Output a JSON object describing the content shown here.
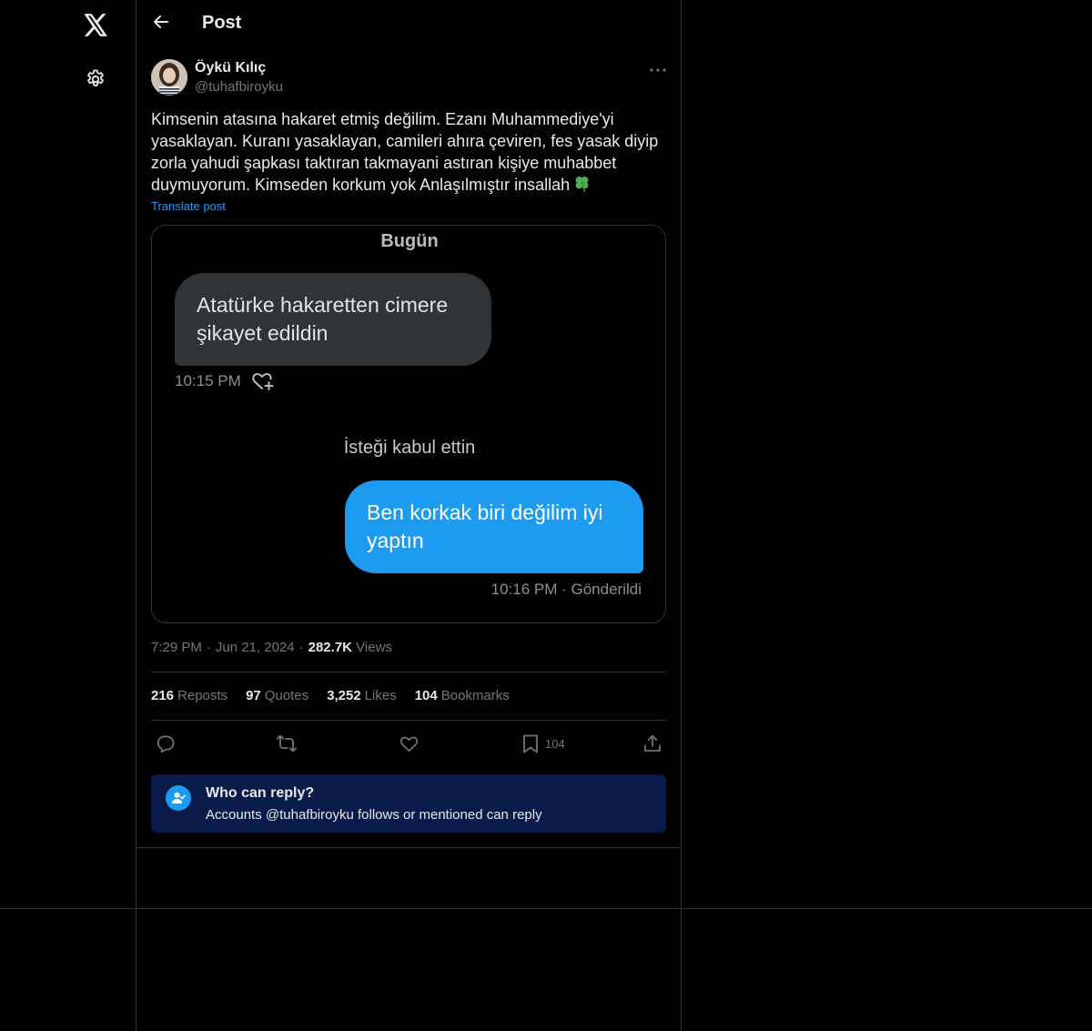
{
  "nav": {
    "logo_icon": "x-logo-icon",
    "settings_icon": "gear-icon"
  },
  "header": {
    "title": "Post",
    "back_icon": "arrow-left-icon"
  },
  "post": {
    "author_name": "Öykü Kılıç",
    "author_handle": "@tuhafbiroyku",
    "text": "Kimsenin atasına hakaret etmiş değilim. Ezanı Muhammediye'yi yasaklayan. Kuranı yasaklayan, camileri ahıra çeviren, fes yasak diyip zorla yahudi şapkası taktıran takmayani astıran kişiye muhabbet duymuyorum. Kimseden korkum yok Anlaşılmıştır insallah",
    "translate_label": "Translate post",
    "time": "7:29 PM",
    "date": "Jun 21, 2024",
    "views_count": "282.7K",
    "views_label": "Views"
  },
  "media": {
    "date_label": "Bugün",
    "incoming_message": "Atatürke hakaretten cimere şikayet edildin",
    "incoming_time": "10:15 PM",
    "accept_notice": "İsteği kabul ettin",
    "outgoing_message": "Ben korkak biri değilim iyi yaptın",
    "outgoing_status": "10:16 PM · Gönderildi"
  },
  "stats": {
    "reposts_count": "216",
    "reposts_label": "Reposts",
    "quotes_count": "97",
    "quotes_label": "Quotes",
    "likes_count": "3,252",
    "likes_label": "Likes",
    "bookmarks_count": "104",
    "bookmarks_label": "Bookmarks"
  },
  "actions": {
    "reply_icon": "reply-icon",
    "repost_icon": "repost-icon",
    "like_icon": "heart-icon",
    "bookmark_icon": "bookmark-icon",
    "bookmark_count": "104",
    "share_icon": "share-icon"
  },
  "reply_restriction": {
    "title": "Who can reply?",
    "subtitle": "Accounts @tuhafbiroyku follows or mentioned can reply"
  },
  "colors": {
    "accent": "#1d9bf0",
    "background": "#000000",
    "border": "#2f3336",
    "muted_text": "#71767b",
    "reply_box": "#0a1a4a"
  }
}
